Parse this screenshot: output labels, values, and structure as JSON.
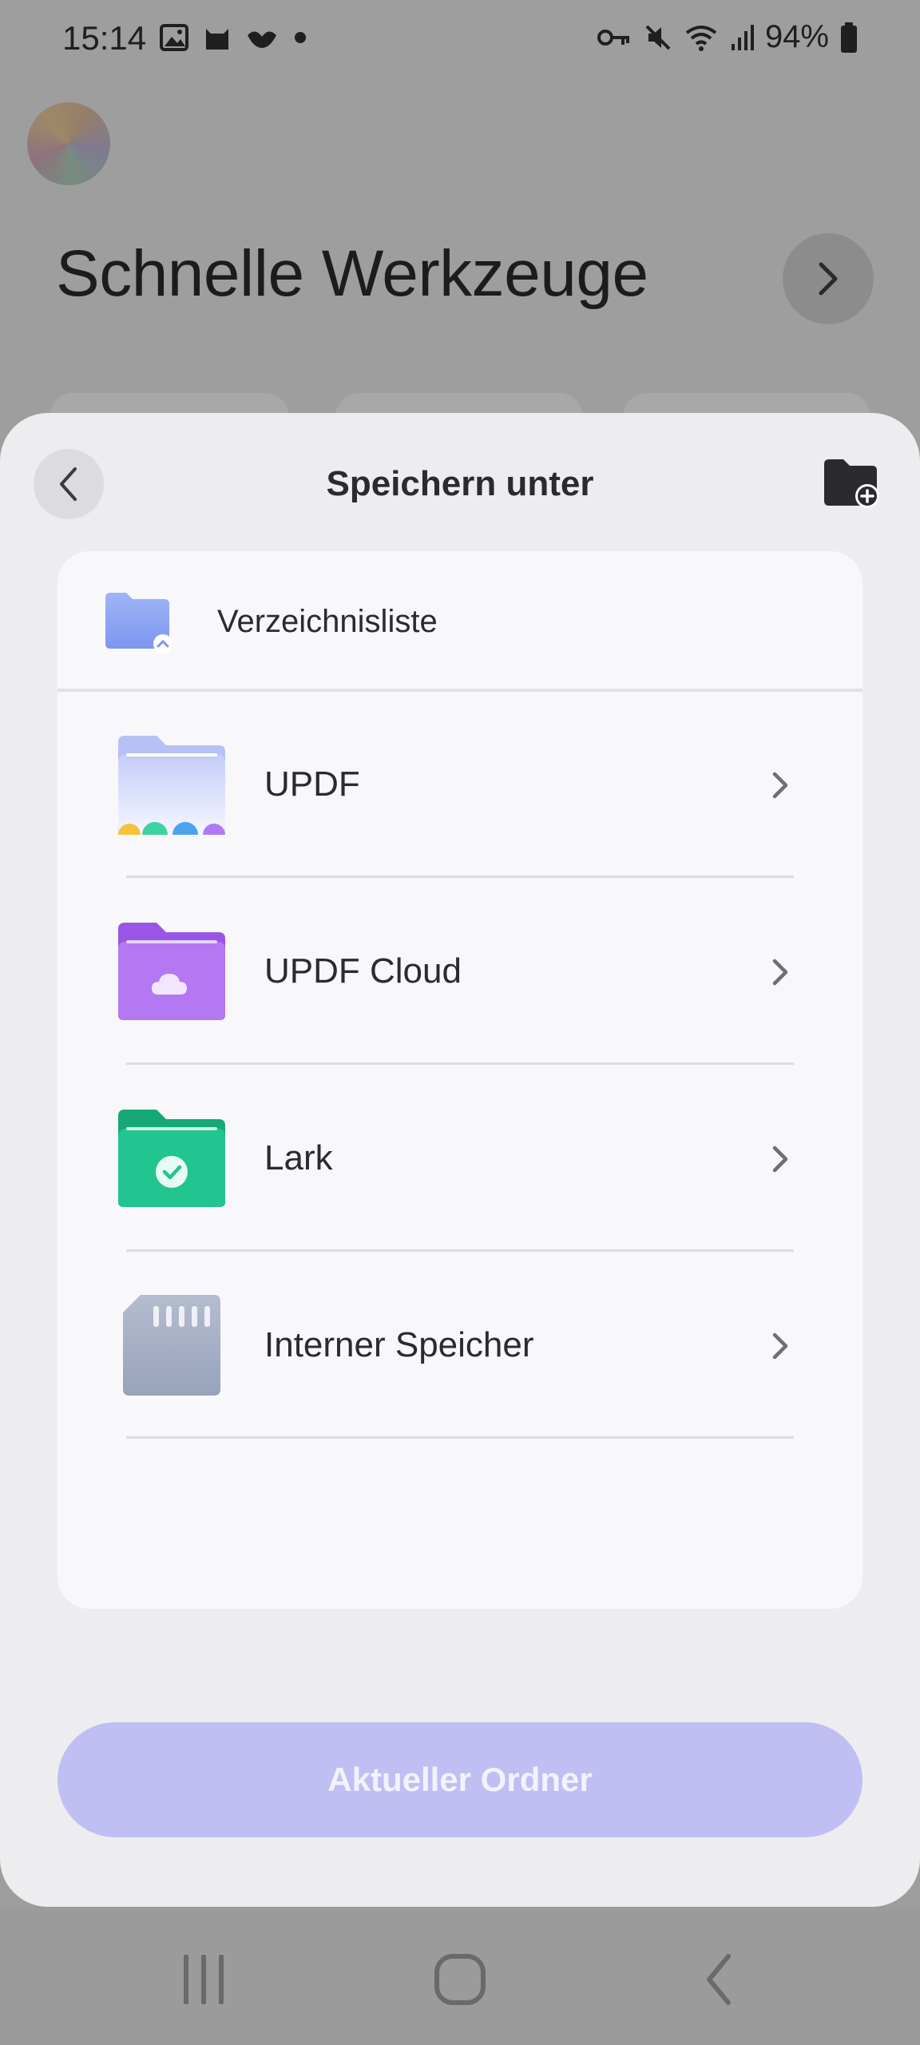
{
  "status_bar": {
    "time": "15:14",
    "battery": "94%",
    "left_icons": [
      "gallery-icon",
      "cat-app-icon",
      "bird-app-icon",
      "dot-icon"
    ],
    "right_icons": [
      "vpn-key-icon",
      "mute-icon",
      "wifi-icon",
      "signal-icon",
      "battery-icon"
    ]
  },
  "background": {
    "title": "Schnelle Werkzeuge"
  },
  "sheet": {
    "title": "Speichern unter",
    "directory_label": "Verzeichnisliste",
    "items": [
      {
        "label": "UPDF",
        "icon": "updf-folder-icon"
      },
      {
        "label": "UPDF Cloud",
        "icon": "cloud-folder-icon"
      },
      {
        "label": "Lark",
        "icon": "lark-folder-icon"
      },
      {
        "label": "Interner Speicher",
        "icon": "sd-card-icon"
      }
    ],
    "primary_button": "Aktueller Ordner"
  },
  "colors": {
    "accent_disabled": "#c0bff4",
    "sheet_bg": "#ededf0",
    "card_bg": "#f8f8fa",
    "cloud_folder": "#b06ef0",
    "lark_folder": "#22c48f"
  }
}
